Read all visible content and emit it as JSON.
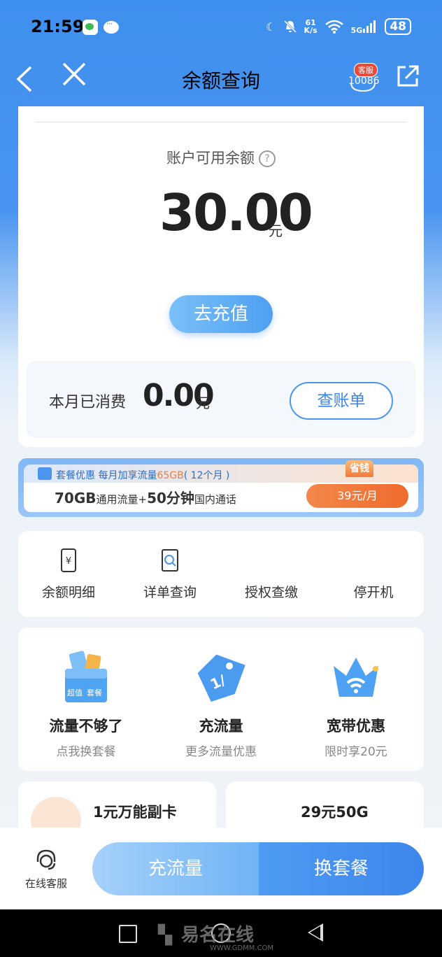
{
  "status_bar": {
    "time": "21:59",
    "net_speed_top": "61",
    "net_speed_bottom": "K/s",
    "signal": "5G",
    "battery": "48"
  },
  "nav": {
    "title": "余额查询",
    "cs_badge": "客服",
    "cs_number": "10086"
  },
  "balance": {
    "label": "账户可用余额",
    "help": "?",
    "amount": "30.00",
    "unit": "元",
    "recharge_label": "去充值"
  },
  "month": {
    "label": "本月已消费",
    "amount": "0.00",
    "unit": "元",
    "bill_label": "查账单"
  },
  "promo": {
    "sub_prefix": "套餐优惠 每月加享流量",
    "sub_highlight": "65GB",
    "sub_suffix": "( 12个月 )",
    "main_a": "70GB",
    "main_b": "通用流量+",
    "main_c": "50分钟",
    "main_d": "国内通话",
    "save_tag": "省钱",
    "price": "39元/月"
  },
  "quick_actions": [
    {
      "label": "余额明细",
      "icon": "phone-yuan-icon"
    },
    {
      "label": "详单查询",
      "icon": "document-search-icon"
    },
    {
      "label": "授权查缴",
      "icon": ""
    },
    {
      "label": "停开机",
      "icon": ""
    }
  ],
  "features": [
    {
      "title": "流量不够了",
      "sub": "点我换套餐",
      "icon": "package-box-icon",
      "icon_text_a": "超值",
      "icon_text_b": "套餐"
    },
    {
      "title": "充流量",
      "sub": "更多流量优惠",
      "icon": "price-tag-icon"
    },
    {
      "title": "宽带优惠",
      "sub": "限时享20元",
      "icon": "crown-wifi-icon"
    }
  ],
  "offers": [
    {
      "title": "1元万能副卡"
    },
    {
      "title": "29元50G"
    }
  ],
  "bottom": {
    "cs_label": "在线客服",
    "left_button": "充流量",
    "right_button": "换套餐"
  },
  "watermark": {
    "text": "易名在线",
    "sub": "WWW.GDMM.COM"
  },
  "colors": {
    "primary": "#4994f0",
    "accent": "#ef6b2d",
    "text": "#222222"
  }
}
